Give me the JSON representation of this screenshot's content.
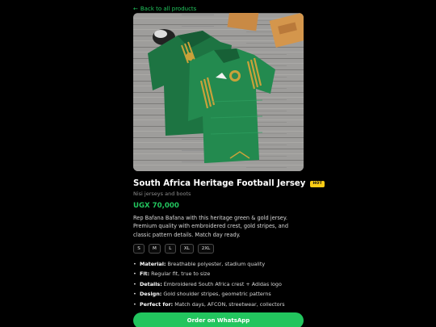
{
  "nav": {
    "back_label": "Back to all products",
    "back_arrow": "←"
  },
  "product": {
    "title": "South Africa Heritage Football Jersey",
    "badge": "HOT",
    "shop": "Nisi jerseys and boots",
    "price": "UGX 70,000",
    "description": "Rep Bafana Bafana with this heritage green & gold jersey. Premium quality with embroidered crest, gold stripes, and classic pattern details. Match day ready.",
    "image_icon": "jersey-photo",
    "sizes": [
      "S",
      "M",
      "L",
      "XL",
      "2XL"
    ],
    "features": [
      {
        "label": "Material:",
        "value": "Breathable polyester, stadium quality"
      },
      {
        "label": "Fit:",
        "value": "Regular fit, true to size"
      },
      {
        "label": "Details:",
        "value": "Embroidered South Africa crest + Adidas logo"
      },
      {
        "label": "Design:",
        "value": "Gold shoulder stripes, geometric patterns"
      },
      {
        "label": "Perfect for:",
        "value": "Match days, AFCON, streetwear, collectors"
      }
    ],
    "order_label": "Order on WhatsApp"
  },
  "colors": {
    "accent": "#22c55e",
    "badge": "#facc15",
    "jersey": "#1f7a45",
    "gold": "#c9a23a"
  }
}
